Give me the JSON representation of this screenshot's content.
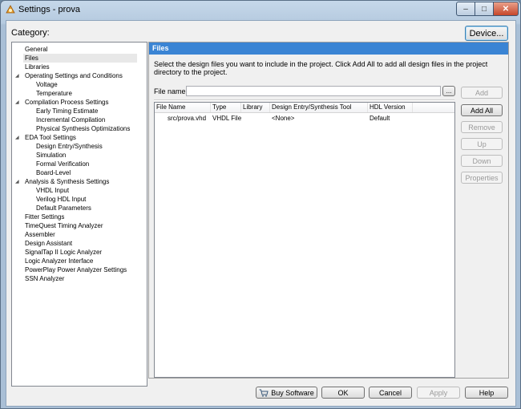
{
  "window": {
    "title": "Settings - prova",
    "controls": {
      "minimize": "–",
      "maximize": "□",
      "close": "✕"
    }
  },
  "category_label": "Category:",
  "device_button": "Device...",
  "tree": {
    "items": [
      {
        "label": "General",
        "expand": ""
      },
      {
        "label": "Files",
        "expand": ""
      },
      {
        "label": "Libraries",
        "expand": ""
      },
      {
        "label": "Operating Settings and Conditions",
        "expand": "◢"
      },
      {
        "label": "Voltage",
        "expand": ""
      },
      {
        "label": "Temperature",
        "expand": ""
      },
      {
        "label": "Compilation Process Settings",
        "expand": "◢"
      },
      {
        "label": "Early Timing Estimate",
        "expand": ""
      },
      {
        "label": "Incremental Compilation",
        "expand": ""
      },
      {
        "label": "Physical Synthesis Optimizations",
        "expand": ""
      },
      {
        "label": "EDA Tool Settings",
        "expand": "◢"
      },
      {
        "label": "Design Entry/Synthesis",
        "expand": ""
      },
      {
        "label": "Simulation",
        "expand": ""
      },
      {
        "label": "Formal Verification",
        "expand": ""
      },
      {
        "label": "Board-Level",
        "expand": ""
      },
      {
        "label": "Analysis & Synthesis Settings",
        "expand": "◢"
      },
      {
        "label": "VHDL Input",
        "expand": ""
      },
      {
        "label": "Verilog HDL Input",
        "expand": ""
      },
      {
        "label": "Default Parameters",
        "expand": ""
      },
      {
        "label": "Fitter Settings",
        "expand": ""
      },
      {
        "label": "TimeQuest Timing Analyzer",
        "expand": ""
      },
      {
        "label": "Assembler",
        "expand": ""
      },
      {
        "label": "Design Assistant",
        "expand": ""
      },
      {
        "label": "SignalTap II Logic Analyzer",
        "expand": ""
      },
      {
        "label": "Logic Analyzer Interface",
        "expand": ""
      },
      {
        "label": "PowerPlay Power Analyzer Settings",
        "expand": ""
      },
      {
        "label": "SSN Analyzer",
        "expand": ""
      }
    ]
  },
  "panel": {
    "header": "Files",
    "description": "Select the design files you want to include in the project. Click Add All to add all design files in the project directory to the project.",
    "file_name_label": "File name:",
    "file_name_value": "",
    "browse_label": "...",
    "table": {
      "columns": [
        "File Name",
        "Type",
        "Library",
        "Design Entry/Synthesis Tool",
        "HDL Version"
      ],
      "rows": [
        [
          "src/prova.vhd",
          "VHDL File",
          "",
          "<None>",
          "Default"
        ]
      ]
    },
    "side_buttons": {
      "add": "Add",
      "add_all": "Add All",
      "remove": "Remove",
      "up": "Up",
      "down": "Down",
      "properties": "Properties"
    }
  },
  "footer": {
    "buy_software": "Buy Software",
    "ok": "OK",
    "cancel": "Cancel",
    "apply": "Apply",
    "help": "Help"
  }
}
